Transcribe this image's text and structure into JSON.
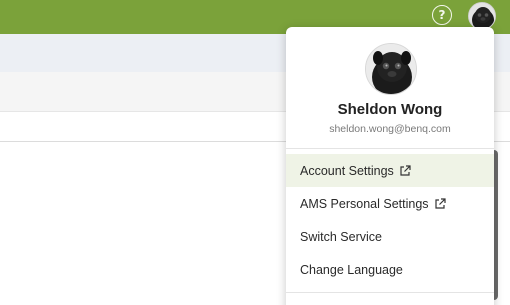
{
  "colors": {
    "topbar": "#7ba23a",
    "menu_hover": "#eff3e6"
  },
  "topbar": {
    "help_icon": "help-circle-icon",
    "help_glyph": "?",
    "avatar_icon": "user-avatar"
  },
  "user_menu": {
    "name": "Sheldon Wong",
    "email": "sheldon.wong@benq.com",
    "items": [
      {
        "label": "Account Settings",
        "external": true,
        "icon": "external-link-icon"
      },
      {
        "label": "AMS Personal Settings",
        "external": true,
        "icon": "external-link-icon"
      },
      {
        "label": "Switch Service",
        "external": false
      },
      {
        "label": "Change Language",
        "external": false
      }
    ]
  }
}
